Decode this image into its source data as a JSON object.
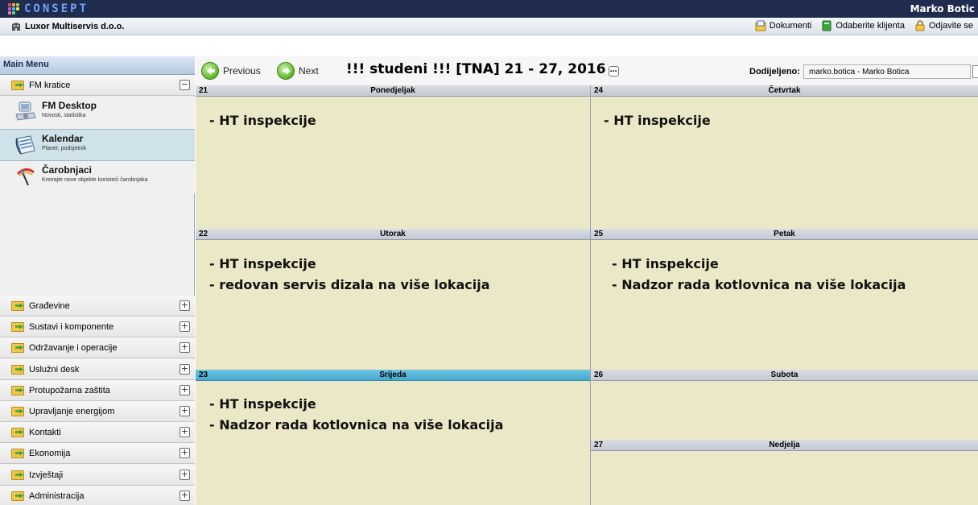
{
  "app": {
    "logo_text": "CONSEPT",
    "user_name": "Marko Botic"
  },
  "subbar": {
    "company": "Luxor Multiservis d.o.o.",
    "actions": [
      {
        "label": "Dokumenti",
        "icon": "documents-icon"
      },
      {
        "label": "Odaberite klijenta",
        "icon": "client-book-icon"
      },
      {
        "label": "Odjavite se",
        "icon": "logout-lock-icon"
      }
    ]
  },
  "sidebar": {
    "main_menu": "Main Menu",
    "fm_kratice": "FM kratice",
    "modules": [
      {
        "title": "FM Desktop",
        "subtitle": "Novosti, statistika",
        "icon": "desktop-icon"
      },
      {
        "title": "Kalendar",
        "subtitle": "Planer, podsjetnik",
        "icon": "calendar-icon"
      },
      {
        "title": "Čarobnjaci",
        "subtitle": "Kreirajte nove objekte koristeći čarobnjaka",
        "icon": "wizard-icon"
      }
    ],
    "sections": [
      "Građevine",
      "Sustavi i komponente",
      "Održavanje i operacije",
      "Uslužni desk",
      "Protupožarna zaštita",
      "Upravljanje energijom",
      "Kontakti",
      "Ekonomija",
      "Izvještaji",
      "Administracija"
    ],
    "toggle_collapse": "−",
    "toggle_expand": "+"
  },
  "toolbar": {
    "previous": "Previous",
    "next": "Next",
    "week_title": "!!! studeni !!! [TNA] 21 - 27, 2016",
    "assigned_label": "Dodijeljeno:",
    "assigned_value": "marko.botica - Marko Botica"
  },
  "days": [
    {
      "num": "21",
      "name": "Ponedjeljak",
      "today": false,
      "events": [
        "- HT inspekcije"
      ]
    },
    {
      "num": "22",
      "name": "Utorak",
      "today": false,
      "events": [
        "- HT inspekcije",
        "- redovan servis dizala na više lokacija"
      ]
    },
    {
      "num": "23",
      "name": "Srijeda",
      "today": true,
      "events": [
        "- HT inspekcije",
        "- Nadzor rada kotlovnica na više lokacija"
      ]
    },
    {
      "num": "24",
      "name": "Četvrtak",
      "today": false,
      "events": [
        "- HT inspekcije"
      ]
    },
    {
      "num": "25",
      "name": "Petak",
      "today": false,
      "events": [
        "- HT inspekcije",
        "- Nadzor rada kotlovnica na više lokacija"
      ]
    },
    {
      "num": "26",
      "name": "Subota",
      "today": false,
      "events": []
    },
    {
      "num": "27",
      "name": "Nedjelja",
      "today": false,
      "events": []
    }
  ]
}
